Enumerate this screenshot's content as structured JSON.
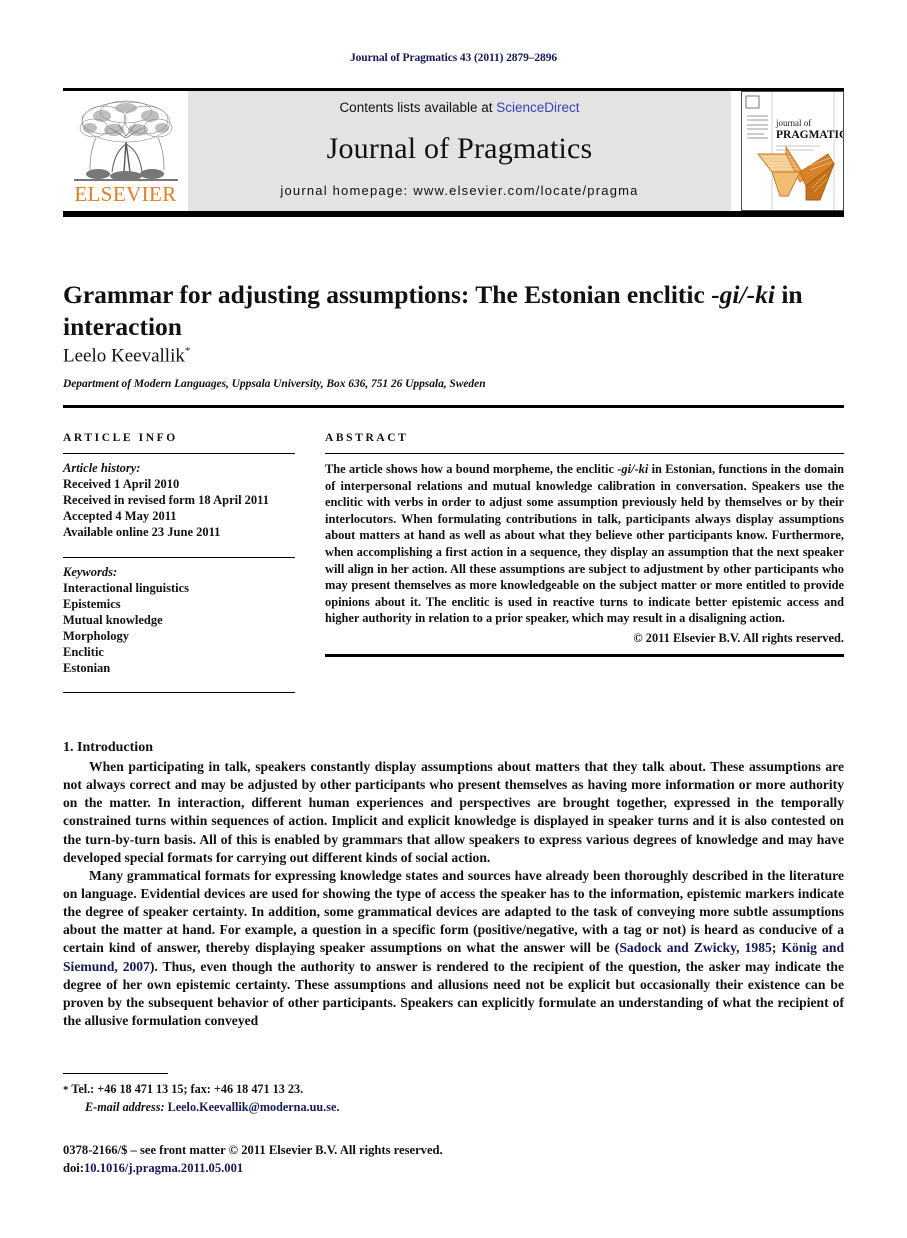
{
  "running_head": "Journal of Pragmatics 43 (2011) 2879–2896",
  "masthead": {
    "contents_prefix": "Contents lists available at ",
    "sciencedirect": "ScienceDirect",
    "journal_name": "Journal of Pragmatics",
    "homepage": "journal homepage: www.elsevier.com/locate/pragma",
    "publisher_word": "ELSEVIER",
    "cover_journal_of": "journal of",
    "cover_title": "PRAGMATICS",
    "accent_orange": "#e87b1e",
    "link_blue": "#3b41b8"
  },
  "article": {
    "title_part1": "Grammar for adjusting assumptions: The Estonian enclitic ",
    "title_italic": "-gi/-ki",
    "title_part2": " in interaction",
    "author": "Leelo Keevallik",
    "author_marker": "*",
    "affiliation": "Department of Modern Languages, Uppsala University, Box 636, 751 26 Uppsala, Sweden"
  },
  "info": {
    "heading": "ARTICLE INFO",
    "history_label": "Article history:",
    "history": [
      "Received 1 April 2010",
      "Received in revised form 18 April 2011",
      "Accepted 4 May 2011",
      "Available online 23 June 2011"
    ],
    "keywords_label": "Keywords:",
    "keywords": [
      "Interactional linguistics",
      "Epistemics",
      "Mutual knowledge",
      "Morphology",
      "Enclitic",
      "Estonian"
    ]
  },
  "abstract": {
    "heading": "ABSTRACT",
    "p1": "The article shows how a bound morpheme, the enclitic ",
    "p1_italic": "-gi/-ki",
    "p2": " in Estonian, functions in the domain of interpersonal relations and mutual knowledge calibration in conversation. Speakers use the enclitic with verbs in order to adjust some assumption previously held by themselves or by their interlocutors. When formulating contributions in talk, participants always display assumptions about matters at hand as well as about what they believe other participants know. Furthermore, when accomplishing a first action in a sequence, they display an assumption that the next speaker will align in her action. All these assumptions are subject to adjustment by other participants who may present themselves as more knowledgeable on the subject matter or more entitled to provide opinions about it. The enclitic is used in reactive turns to indicate better epistemic access and higher authority in relation to a prior speaker, which may result in a disaligning action.",
    "copyright": "© 2011 Elsevier B.V. All rights reserved."
  },
  "section": {
    "heading": "1. Introduction",
    "para1": "When participating in talk, speakers constantly display assumptions about matters that they talk about. These assumptions are not always correct and may be adjusted by other participants who present themselves as having more information or more authority on the matter. In interaction, different human experiences and perspectives are brought together, expressed in the temporally constrained turns within sequences of action. Implicit and explicit knowledge is displayed in speaker turns and it is also contested on the turn-by-turn basis. All of this is enabled by grammars that allow speakers to express various degrees of knowledge and may have developed special formats for carrying out different kinds of social action.",
    "para2_a": "Many grammatical formats for expressing knowledge states and sources have already been thoroughly described in the literature on language. Evidential devices are used for showing the type of access the speaker has to the information, epistemic markers indicate the degree of speaker certainty. In addition, some grammatical devices are adapted to the task of conveying more subtle assumptions about the matter at hand. For example, a question in a specific form (positive/negative, with a tag or not) is heard as conducive of a certain kind of answer, thereby displaying speaker assumptions on what the answer will be (",
    "para2_cite": "Sadock and Zwicky, 1985; König and Siemund, 2007",
    "para2_b": "). Thus, even though the authority to answer is rendered to the recipient of the question, the asker may indicate the degree of her own epistemic certainty. These assumptions and allusions need not be explicit but occasionally their existence can be proven by the subsequent behavior of other participants. Speakers can explicitly formulate an understanding of what the recipient of the allusive formulation conveyed"
  },
  "footer": {
    "star": "*",
    "contact": "Tel.: +46 18 471 13 15; fax: +46 18 471 13 23.",
    "email_label": "E-mail address:",
    "email": "Leelo.Keevallik@moderna.uu.se",
    "imprint": "0378-2166/$ – see front matter © 2011 Elsevier B.V. All rights reserved.",
    "doi_label": "doi:",
    "doi": "10.1016/j.pragma.2011.05.001"
  }
}
